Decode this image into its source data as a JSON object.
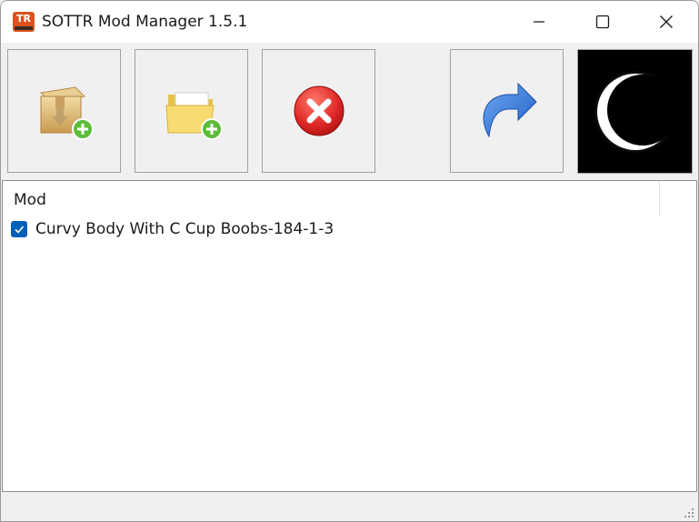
{
  "window": {
    "title": "SOTTR Mod Manager 1.5.1",
    "app_icon_text": "TR"
  },
  "toolbar": {
    "buttons": [
      {
        "name": "install-mod-button",
        "icon": "package-add-icon"
      },
      {
        "name": "add-folder-button",
        "icon": "folder-add-icon"
      },
      {
        "name": "remove-mod-button",
        "icon": "red-x-icon"
      },
      {
        "name": "refresh-button",
        "icon": "redo-arrow-icon"
      },
      {
        "name": "theme-button",
        "icon": "eclipse-icon"
      }
    ]
  },
  "list": {
    "column_header": "Mod",
    "rows": [
      {
        "label": "Curvy Body With C Cup Boobs-184-1-3",
        "checked": true
      }
    ]
  },
  "colors": {
    "checkbox": "#005fb8",
    "remove_red": "#d42020",
    "arrow_blue": "#2e72d6"
  }
}
